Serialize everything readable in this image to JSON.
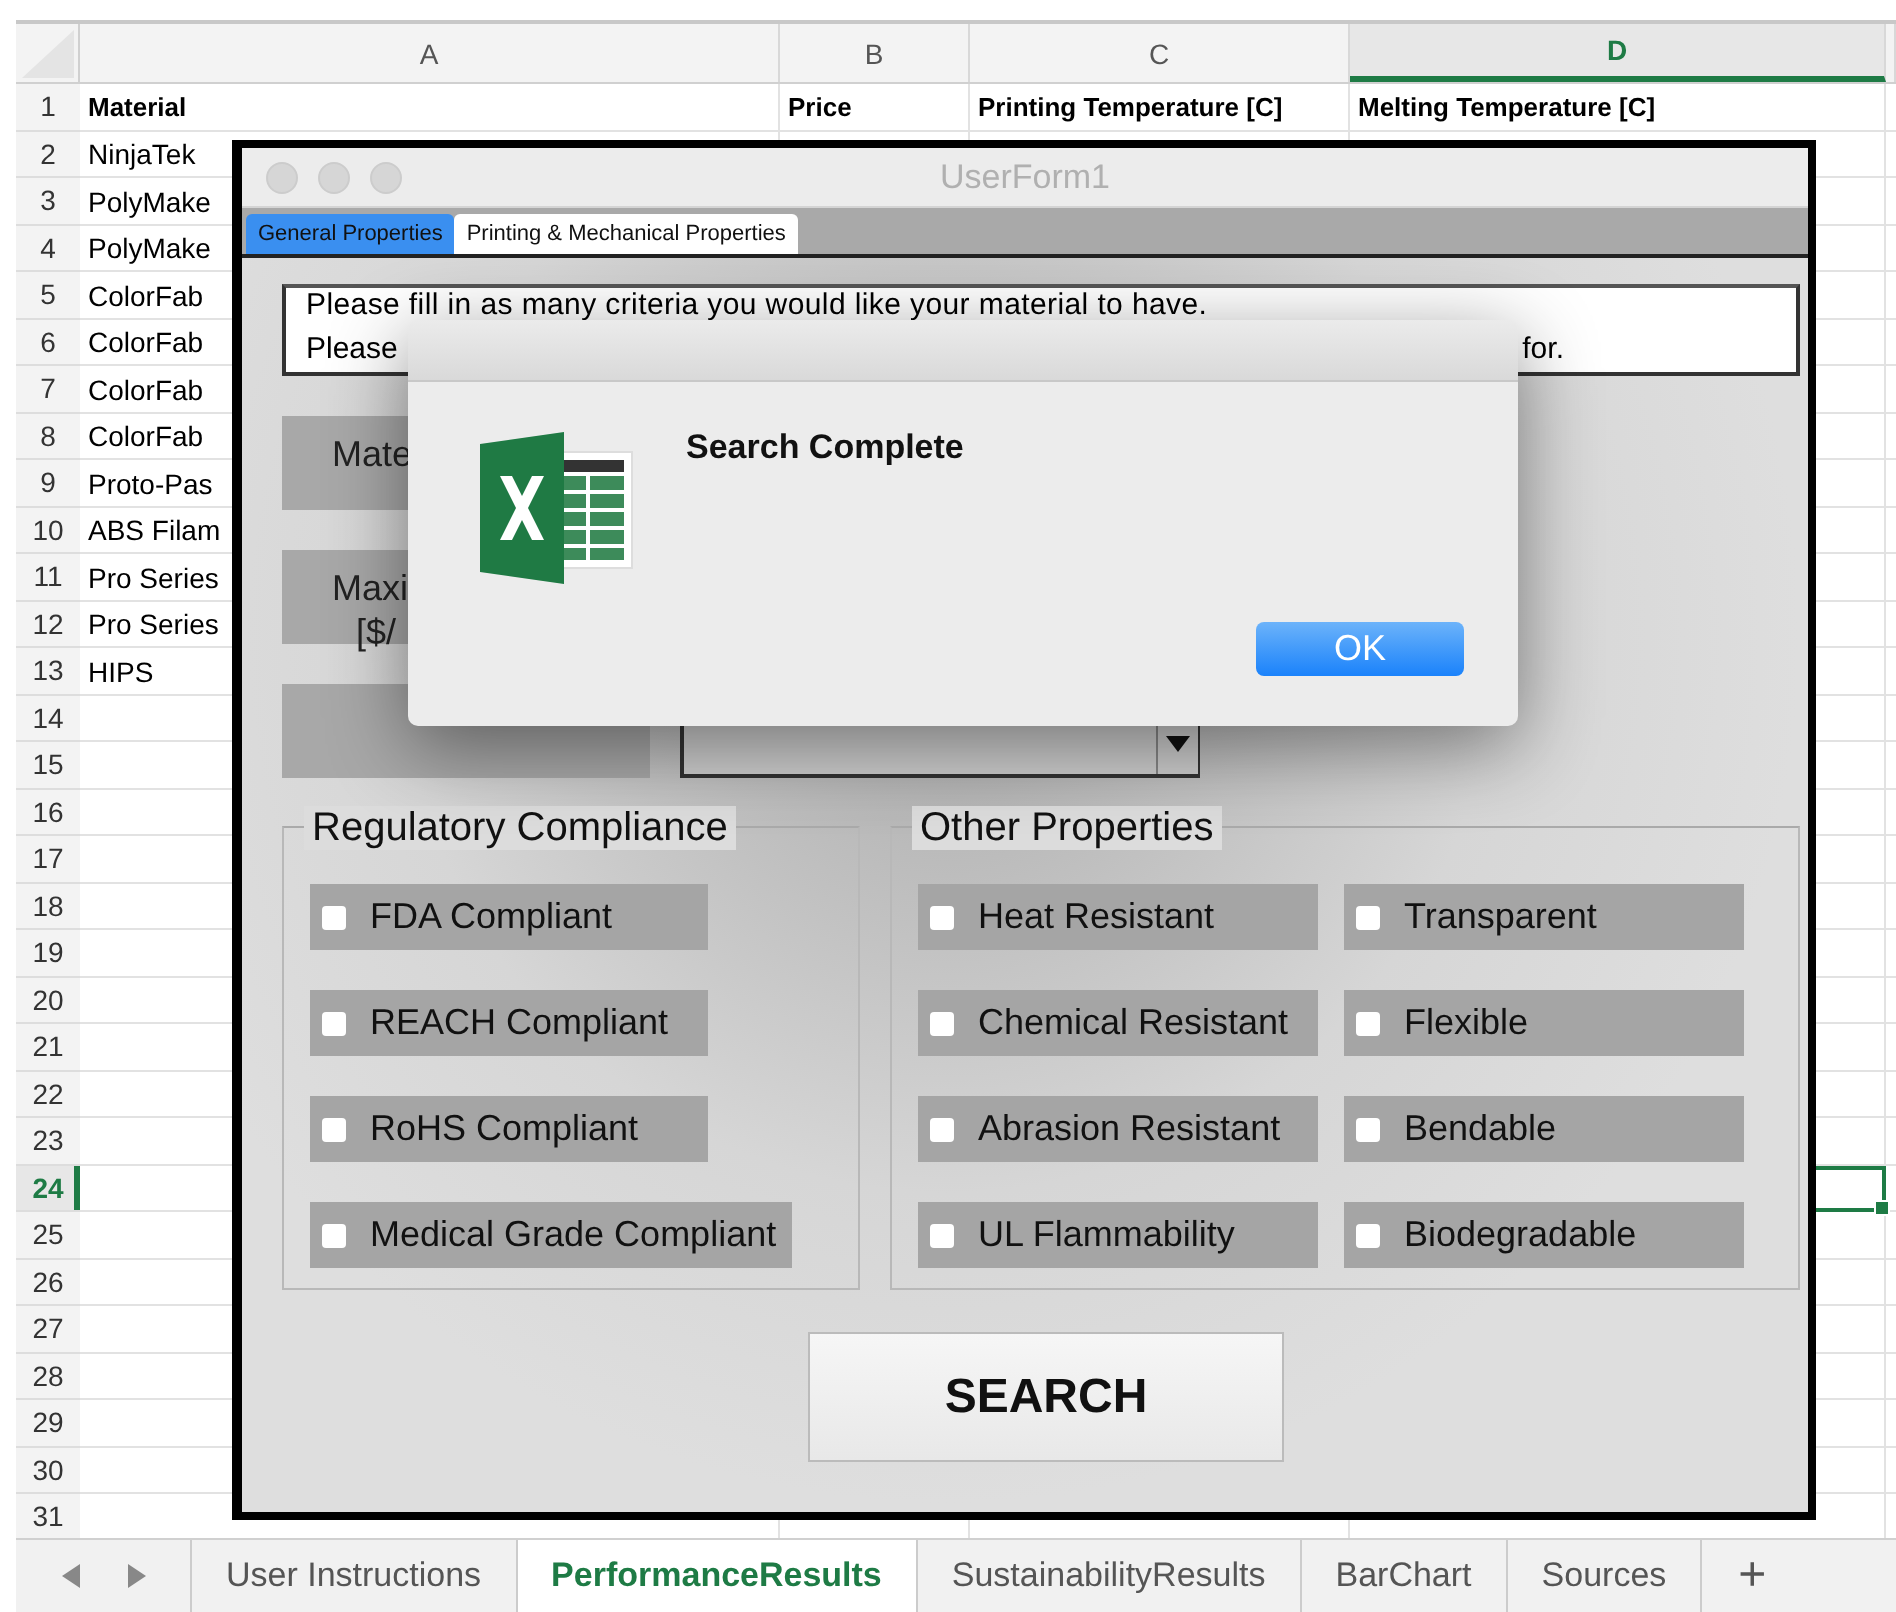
{
  "spreadsheet": {
    "columns": [
      {
        "label": "A",
        "selected": false
      },
      {
        "label": "B",
        "selected": false
      },
      {
        "label": "C",
        "selected": false
      },
      {
        "label": "D",
        "selected": true
      }
    ],
    "rows": [
      {
        "number": "1",
        "selected": false,
        "cells": [
          "Material",
          "Price",
          "Printing Temperature [C]",
          "Melting Temperature [C]"
        ]
      },
      {
        "number": "2",
        "selected": false,
        "cells": [
          "NinjaTek"
        ]
      },
      {
        "number": "3",
        "selected": false,
        "cells": [
          "PolyMake"
        ]
      },
      {
        "number": "4",
        "selected": false,
        "cells": [
          "PolyMake"
        ]
      },
      {
        "number": "5",
        "selected": false,
        "cells": [
          "ColorFab"
        ]
      },
      {
        "number": "6",
        "selected": false,
        "cells": [
          "ColorFab"
        ]
      },
      {
        "number": "7",
        "selected": false,
        "cells": [
          "ColorFab"
        ]
      },
      {
        "number": "8",
        "selected": false,
        "cells": [
          "ColorFab"
        ]
      },
      {
        "number": "9",
        "selected": false,
        "cells": [
          "Proto-Pas"
        ]
      },
      {
        "number": "10",
        "selected": false,
        "cells": [
          "ABS Filam"
        ]
      },
      {
        "number": "11",
        "selected": false,
        "cells": [
          "Pro Series"
        ]
      },
      {
        "number": "12",
        "selected": false,
        "cells": [
          "Pro Series"
        ]
      },
      {
        "number": "13",
        "selected": false,
        "cells": [
          "HIPS"
        ]
      },
      {
        "number": "14",
        "selected": false
      },
      {
        "number": "15",
        "selected": false
      },
      {
        "number": "16",
        "selected": false
      },
      {
        "number": "17",
        "selected": false
      },
      {
        "number": "18",
        "selected": false
      },
      {
        "number": "19",
        "selected": false
      },
      {
        "number": "20",
        "selected": false
      },
      {
        "number": "21",
        "selected": false
      },
      {
        "number": "22",
        "selected": false
      },
      {
        "number": "23",
        "selected": false
      },
      {
        "number": "24",
        "selected": true
      },
      {
        "number": "25",
        "selected": false
      },
      {
        "number": "26",
        "selected": false
      },
      {
        "number": "27",
        "selected": false
      },
      {
        "number": "28",
        "selected": false
      },
      {
        "number": "29",
        "selected": false
      },
      {
        "number": "30",
        "selected": false
      },
      {
        "number": "31",
        "selected": false
      }
    ]
  },
  "userform": {
    "title": "UserForm1",
    "tabs": [
      {
        "label": "General Properties",
        "selected": true
      },
      {
        "label": "Printing & Mechanical Properties",
        "selected": false
      }
    ],
    "instructions": {
      "line_1": "Please fill in as many criteria you would like your material to have.",
      "line_2_start": "Please",
      "line_2_end": "for."
    },
    "criteria": [
      {
        "label_lines": [
          "Mate"
        ]
      },
      {
        "label_lines": [
          "Maxi",
          "[$/"
        ]
      },
      {
        "kind": "dropdown"
      }
    ],
    "groups": [
      {
        "title": "Regulatory Compliance",
        "columns": [
          [
            {
              "label": "FDA Compliant",
              "checked": false
            },
            {
              "label": "REACH Compliant",
              "checked": false
            },
            {
              "label": "RoHS Compliant",
              "checked": false
            },
            {
              "label": "Medical Grade Compliant",
              "checked": false
            }
          ]
        ]
      },
      {
        "title": "Other Properties",
        "columns": [
          [
            {
              "label": "Heat Resistant",
              "checked": false
            },
            {
              "label": "Chemical Resistant",
              "checked": false
            },
            {
              "label": "Abrasion Resistant",
              "checked": false
            },
            {
              "label": "UL Flammability",
              "checked": false
            }
          ],
          [
            {
              "label": "Transparent",
              "checked": false
            },
            {
              "label": "Flexible",
              "checked": false
            },
            {
              "label": "Bendable",
              "checked": false
            },
            {
              "label": "Biodegradable",
              "checked": false
            }
          ]
        ]
      }
    ],
    "search_button": "SEARCH"
  },
  "dialog": {
    "message": "Search Complete",
    "button": "OK"
  },
  "sheet_tabs": [
    {
      "label": "User Instructions",
      "selected": false
    },
    {
      "label": "PerformanceResults",
      "selected": true
    },
    {
      "label": "SustainabilityResults",
      "selected": false
    },
    {
      "label": "BarChart",
      "selected": false
    },
    {
      "label": "Sources",
      "selected": false
    }
  ],
  "add_sheet": "+"
}
